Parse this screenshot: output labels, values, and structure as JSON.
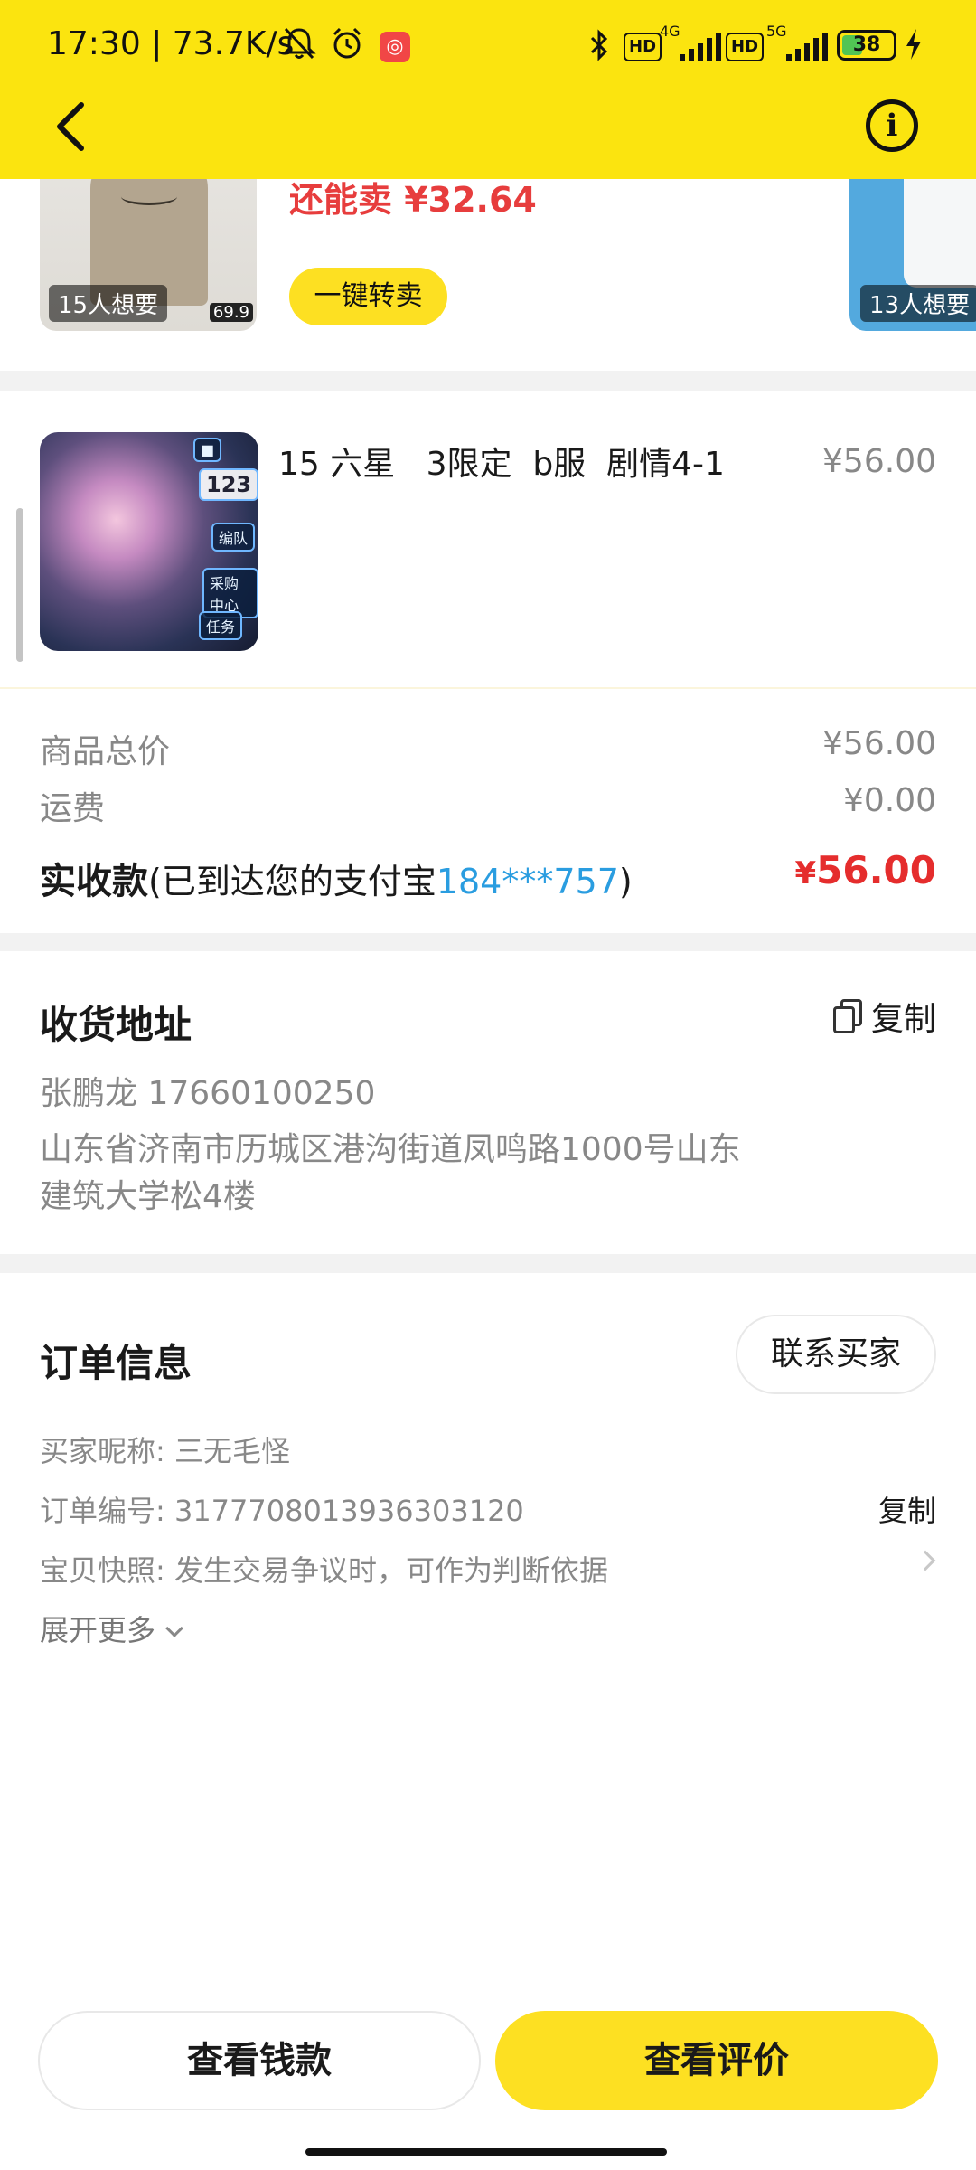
{
  "status_bar": {
    "time_speed": "17:30 | 73.7K/s",
    "network_4g": "4G",
    "network_5g": "5G",
    "hd_label": "HD",
    "battery": "38"
  },
  "nav": {
    "back_icon": "chevron-left-icon",
    "info_icon": "info-icon"
  },
  "recommendations": {
    "resell_price": "还能卖 ¥32.64",
    "resell_button": "一键转卖",
    "items": [
      {
        "want_count": "15人想要",
        "price_overlay": "69.9"
      },
      {
        "want_count": "13人想要"
      }
    ]
  },
  "product": {
    "title": "15 六星   3限定  b服  剧情4-1",
    "price": "¥56.00",
    "thumb_badge": "123",
    "thumb_labels": [
      "编队",
      "任务",
      "采购中心"
    ]
  },
  "summary": {
    "goods_total_label": "商品总价",
    "goods_total_value": "¥56.00",
    "shipping_label": "运费",
    "shipping_value": "¥0.00",
    "received_label": "实收款",
    "received_note_prefix": "(已到达您的支付宝",
    "received_account": "184***757",
    "received_note_suffix": ")",
    "received_currency": "¥",
    "received_amount": "56.00"
  },
  "address": {
    "title": "收货地址",
    "copy_label": "复制",
    "name_phone": "张鹏龙 17660100250",
    "line1": "山东省济南市历城区港沟街道凤鸣路1000号山东",
    "line2": "建筑大学松4楼"
  },
  "order": {
    "title": "订单信息",
    "contact_button": "联系买家",
    "buyer_nickname": "买家昵称: 三无毛怪",
    "order_number": "订单编号: 3177708013936303120",
    "order_copy": "复制",
    "snapshot": "宝贝快照: 发生交易争议时，可作为判断依据",
    "expand_more": "展开更多"
  },
  "bottom": {
    "view_money": "查看钱款",
    "view_review": "查看评价"
  },
  "colors": {
    "brand_yellow": "#fde022",
    "price_red": "#e52d2d",
    "link_blue": "#2a9de0"
  }
}
